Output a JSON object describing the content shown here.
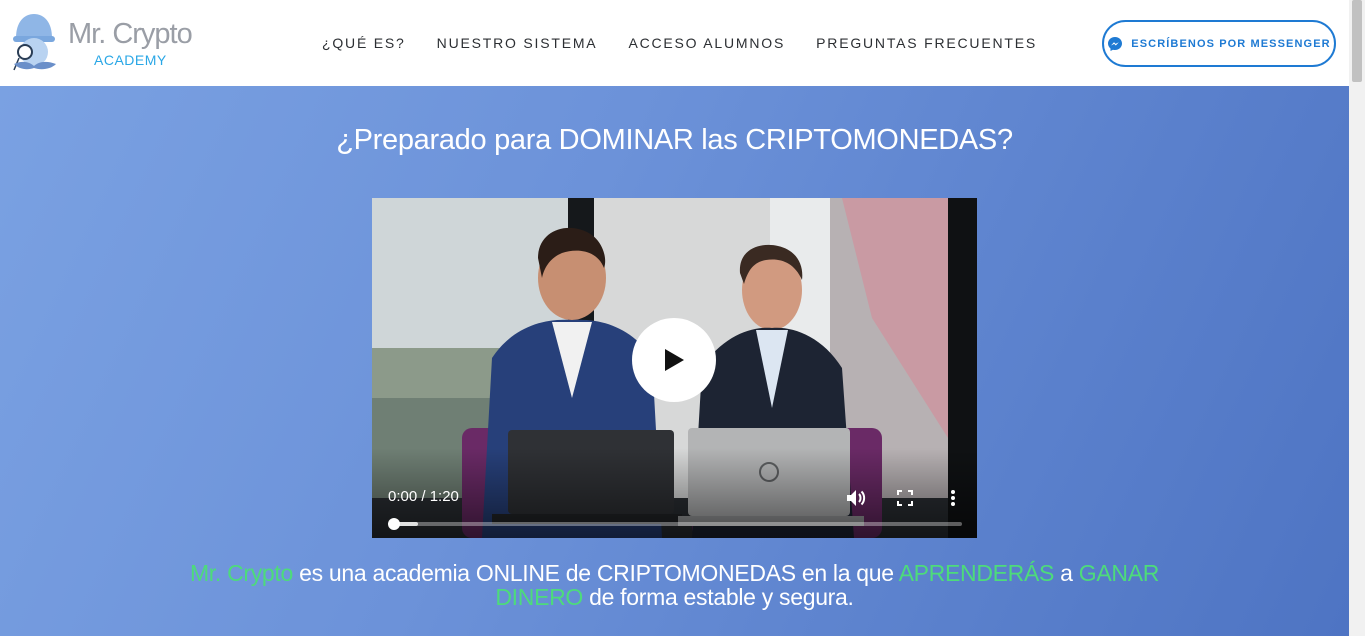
{
  "brand": {
    "name": "Mr. Crypto",
    "sub": "ACADEMY"
  },
  "nav": {
    "items": [
      {
        "label": "¿QUÉ ES?"
      },
      {
        "label": "NUESTRO SISTEMA"
      },
      {
        "label": "ACCESO ALUMNOS"
      },
      {
        "label": "PREGUNTAS FRECUENTES"
      }
    ]
  },
  "cta": {
    "label": "ESCRÍBENOS POR MESSENGER",
    "icon": "messenger-icon",
    "color": "#1e7ad3"
  },
  "hero": {
    "title": "¿Preparado para DOMINAR las CRIPTOMONEDAS?",
    "description": {
      "brand": "Mr. Crypto",
      "text1": " es una academia ONLINE de CRIPTOMONEDAS en la que ",
      "hl1": "APRENDERÁS",
      "text2": " a ",
      "hl2": "GANAR DINERO",
      "text3": " de forma estable y segura."
    },
    "highlight_color": "#4ddb7b",
    "background_colors": [
      "#7aa1e2",
      "#4e74c3"
    ]
  },
  "video": {
    "time": "0:00 / 1:20",
    "progress": 0.0
  }
}
